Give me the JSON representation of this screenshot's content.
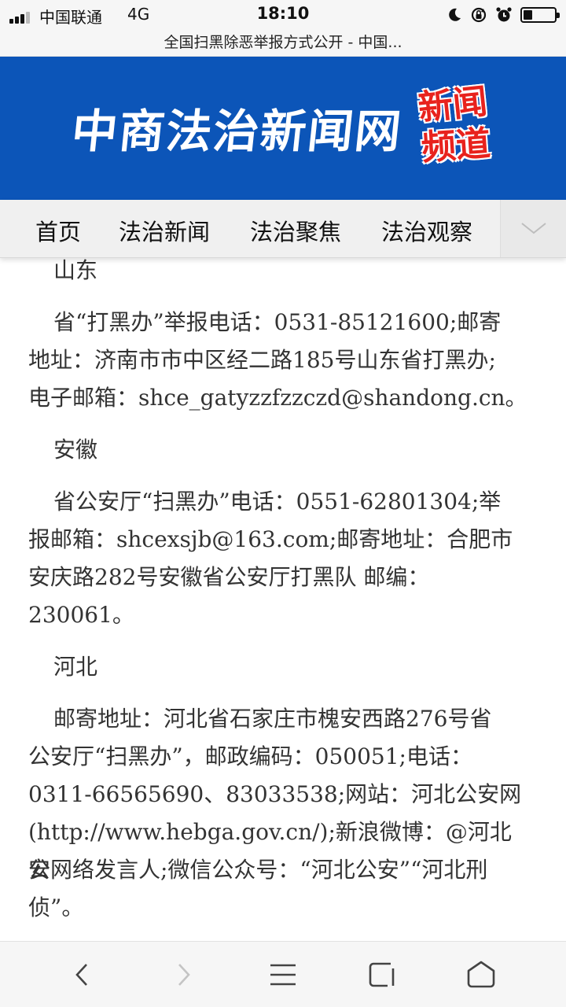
{
  "status_bar": {
    "carrier": "中国联通",
    "network": "4G",
    "time": "18:10",
    "icons": [
      "signal-icon",
      "moon-icon",
      "rotation-lock-icon",
      "alarm-icon",
      "battery-icon"
    ]
  },
  "browser": {
    "page_title": "全国扫黑除恶举报方式公开 - 中国..."
  },
  "banner": {
    "site_name": "中商法治新闻网",
    "badge_line1": "新闻",
    "badge_line2": "频道",
    "background_color": "#0c55b8",
    "badge_color": "#e8221d"
  },
  "nav": {
    "items": [
      "首页",
      "法治新闻",
      "法治聚焦",
      "法治观察"
    ],
    "more_icon": "chevron-down-icon"
  },
  "article": {
    "paragraphs": [
      "山东",
      "省“打黑办”举报电话：0531-85121600;邮寄",
      "地址：济南市市中区经二路185号山东省打黑办;",
      "电子邮箱：shce_gatyzzfzzczd@shandong.cn。",
      "安徽",
      "省公安厅“扫黑办”电话：0551-62801304;举",
      "报邮箱：shcexsjb@163.com;邮寄地址：合肥市",
      "安庆路282号安徽省公安厅打黑队 邮编：",
      "230061。",
      "河北",
      "邮寄地址：河北省石家庄市槐安西路276号省",
      "公安厅“扫黑办”，邮政编码：050051;电话：",
      "0311-66565690、83033538;网站：河北公安网",
      "(http://www.hebga.gov.cn/);新浪微博：@河北公",
      "安网络发言人;微信公众号：“河北公安”“河北刑",
      "侦”。"
    ]
  },
  "toolbar": {
    "icons": [
      "back-icon",
      "forward-icon",
      "menu-icon",
      "tabs-icon",
      "home-icon"
    ]
  }
}
